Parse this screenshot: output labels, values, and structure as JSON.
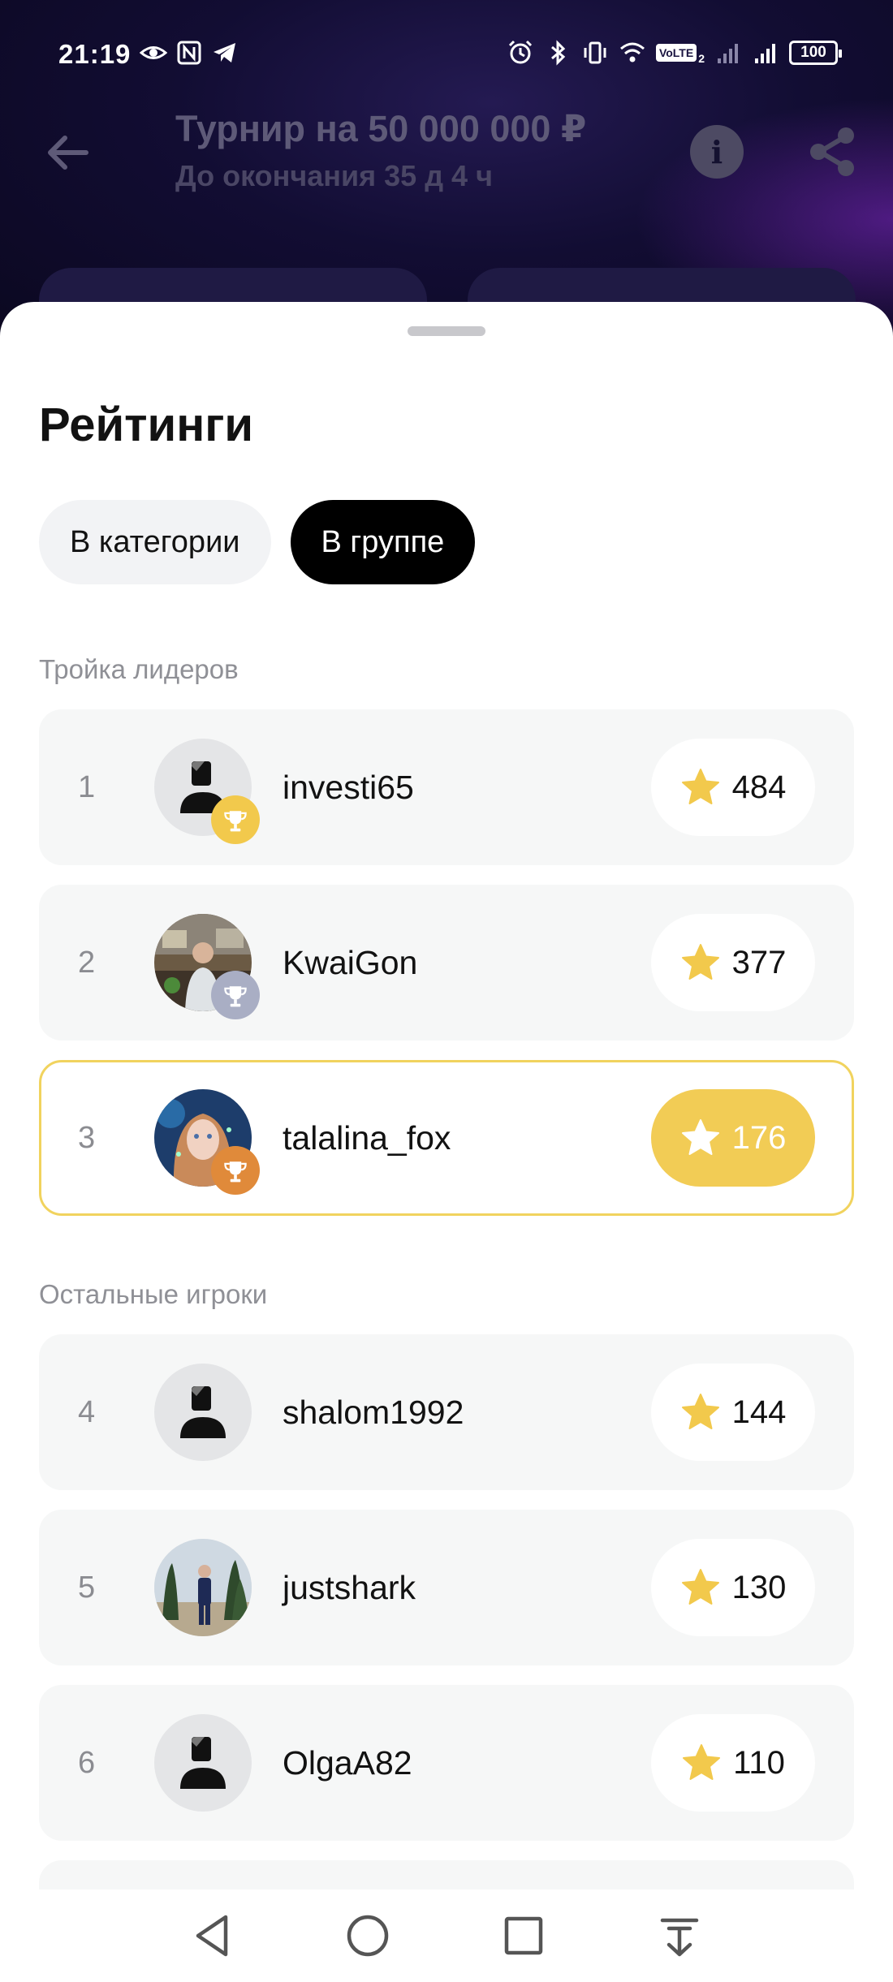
{
  "status_bar": {
    "time": "21:19",
    "battery": "100",
    "network_badge": "VoLTE",
    "sim_index": "2",
    "left_icons": [
      "eye-icon",
      "nfc-icon",
      "telegram-icon"
    ],
    "right_icons": [
      "alarm-icon",
      "bluetooth-icon",
      "vibrate-icon",
      "wifi-icon",
      "signal-icon",
      "signal-icon"
    ]
  },
  "header": {
    "title": "Турнир на 50 000 000 ₽",
    "subtitle": "До окончания 35 д 4 ч"
  },
  "sheet": {
    "title": "Рейтинги",
    "tabs": [
      {
        "label": "В категории",
        "active": false
      },
      {
        "label": "В группе",
        "active": true
      }
    ],
    "leaders_label": "Тройка лидеров",
    "others_label": "Остальные игроки",
    "leaders": [
      {
        "rank": "1",
        "username": "investi65",
        "score": "484",
        "avatar": "default",
        "trophy_color": "#f2c94c",
        "highlighted": false
      },
      {
        "rank": "2",
        "username": "KwaiGon",
        "score": "377",
        "avatar": "photo-cafe",
        "trophy_color": "#a9aec4",
        "highlighted": false
      },
      {
        "rank": "3",
        "username": "talalina_fox",
        "score": "176",
        "avatar": "photo-girl",
        "trophy_color": "#e08a3a",
        "highlighted": true
      }
    ],
    "others": [
      {
        "rank": "4",
        "username": "shalom1992",
        "score": "144",
        "avatar": "default"
      },
      {
        "rank": "5",
        "username": "justshark",
        "score": "130",
        "avatar": "photo-outdoor"
      },
      {
        "rank": "6",
        "username": "OlgaA82",
        "score": "110",
        "avatar": "default"
      }
    ]
  },
  "colors": {
    "accent_gold": "#f2cc55",
    "star": "#f2c94c",
    "active_tab": "#000000"
  },
  "navbar": {
    "buttons": [
      "back-triangle-icon",
      "home-circle-icon",
      "recents-square-icon",
      "notification-pulldown-icon"
    ]
  }
}
